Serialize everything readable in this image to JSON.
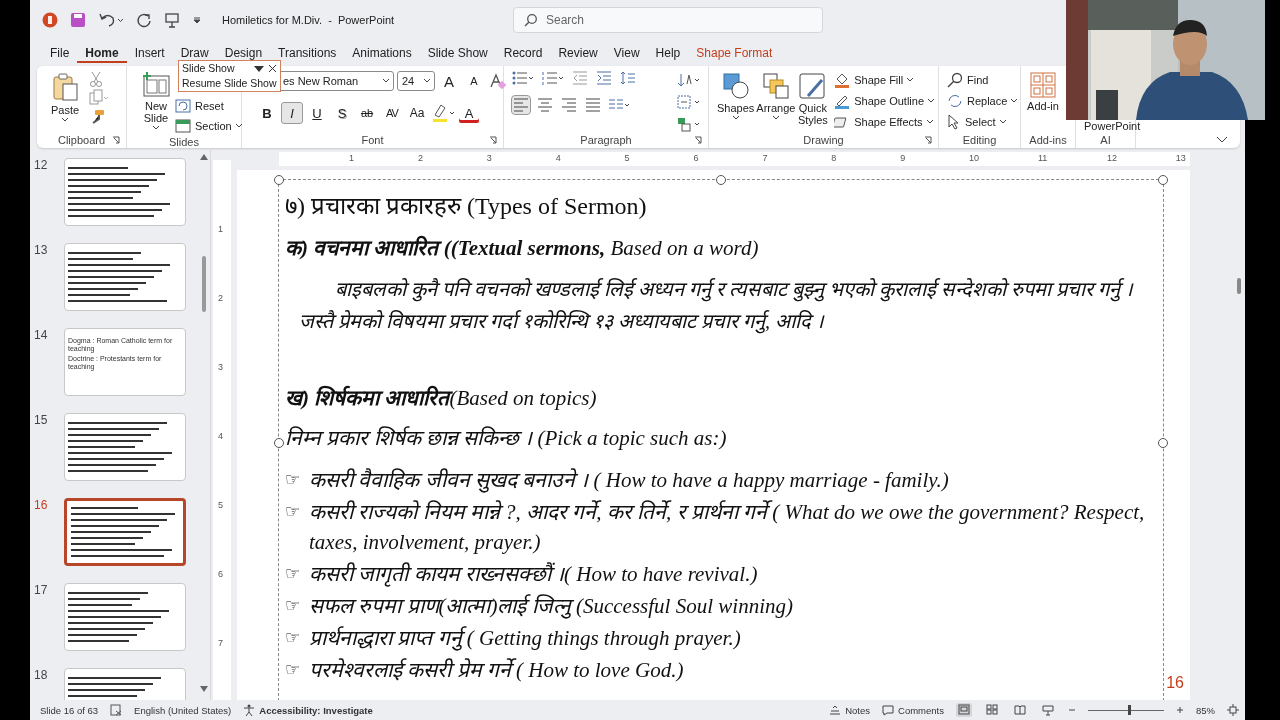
{
  "title_bar": {
    "title": "Homiletics for M.Div.  -  PowerPoint",
    "search_placeholder": "Search"
  },
  "tabs": [
    {
      "label": "File",
      "selected": false,
      "kind": "normal"
    },
    {
      "label": "Home",
      "selected": true,
      "kind": "normal"
    },
    {
      "label": "Insert",
      "selected": false,
      "kind": "normal"
    },
    {
      "label": "Draw",
      "selected": false,
      "kind": "normal"
    },
    {
      "label": "Design",
      "selected": false,
      "kind": "normal"
    },
    {
      "label": "Transitions",
      "selected": false,
      "kind": "normal"
    },
    {
      "label": "Animations",
      "selected": false,
      "kind": "normal"
    },
    {
      "label": "Slide Show",
      "selected": false,
      "kind": "normal"
    },
    {
      "label": "Record",
      "selected": false,
      "kind": "normal"
    },
    {
      "label": "Review",
      "selected": false,
      "kind": "normal"
    },
    {
      "label": "View",
      "selected": false,
      "kind": "normal"
    },
    {
      "label": "Help",
      "selected": false,
      "kind": "normal"
    },
    {
      "label": "Shape Format",
      "selected": false,
      "kind": "contextual"
    }
  ],
  "slideshow_popup": {
    "title": "Slide Show",
    "item": "Resume Slide Show"
  },
  "ribbon": {
    "clipboard": {
      "label": "Clipboard",
      "paste": "Paste"
    },
    "slides": {
      "label": "Slides",
      "new_slide": "New Slide",
      "reset": "Reset",
      "section": "Section"
    },
    "font": {
      "label": "Font",
      "font_name": "es New Roman",
      "font_size": "24",
      "grow": "A",
      "shrink": "A",
      "font_color": "A",
      "styles": [
        {
          "label": "B",
          "selected": false
        },
        {
          "label": "I",
          "selected": true
        },
        {
          "label": "U",
          "selected": false
        },
        {
          "label": "S",
          "selected": false
        },
        {
          "label": "ab",
          "selected": false
        },
        {
          "label": "AV",
          "selected": false
        },
        {
          "label": "Aa",
          "selected": false
        }
      ]
    },
    "paragraph": {
      "label": "Paragraph",
      "alignments": [
        {
          "selected": true
        },
        {
          "selected": false
        },
        {
          "selected": false
        },
        {
          "selected": false
        }
      ]
    },
    "drawing": {
      "label": "Drawing",
      "shapes": "Shapes",
      "arrange": "Arrange",
      "quick_styles": "Quick Styles",
      "shape_fill": "Shape Fill",
      "shape_outline": "Shape Outline",
      "shape_effects": "Shape Effects"
    },
    "editing": {
      "label": "Editing",
      "find": "Find",
      "replace": "Replace",
      "select": "Select"
    },
    "add_ins": {
      "label": "Add-ins",
      "button": "Add-in"
    },
    "ai": {
      "label": "AI",
      "button": "PowerPoint"
    }
  },
  "thumbnails": [
    {
      "number": "12",
      "selected": false,
      "kind": "lines"
    },
    {
      "number": "13",
      "selected": false,
      "kind": "lines"
    },
    {
      "number": "14",
      "selected": false,
      "kind": "text",
      "lines": [
        "Dogma : Roman Catholic term for teaching",
        "Doctrine : Protestants term for teaching"
      ]
    },
    {
      "number": "15",
      "selected": false,
      "kind": "lines"
    },
    {
      "number": "16",
      "selected": true,
      "kind": "lines"
    },
    {
      "number": "17",
      "selected": false,
      "kind": "lines"
    },
    {
      "number": "18",
      "selected": false,
      "kind": "lines"
    }
  ],
  "rulers": {
    "horizontal": [
      "1",
      "2",
      "3",
      "4",
      "5",
      "6",
      "7",
      "8",
      "9",
      "10",
      "11",
      "12",
      "13"
    ],
    "vertical": [
      "1",
      "2",
      "3",
      "4",
      "5",
      "6",
      "7"
    ]
  },
  "slide": {
    "blocks": [
      {
        "kind": "title",
        "text": "७) प्रचारका प्रकारहरु (Types of Sermon)"
      },
      {
        "kind": "heading",
        "text": "**क) वचनमा आधारित ((Textual sermons,** Based on a word)"
      },
      {
        "kind": "paragraph",
        "text": "बाइबलको कुनै पनि वचनको खण्डलाई लिई अध्यन गर्नु र त्यसबाट बुझ्नु भएको कुरालाई सन्देशको रुपमा प्रचार गर्नु । जस्तै प्रेमको विषयमा प्रचार गर्दा १कोरिन्थि १३ अध्यायबाट प्रचार गर्नु, आदि ।"
      },
      {
        "kind": "heading",
        "text": "**ख) शिर्षकमा आधारित**(Based on topics)"
      },
      {
        "kind": "line",
        "text": "निम्न प्रकार शिर्षक छान्न सकिन्छ । (Pick a topic such as:)"
      }
    ],
    "bullets": [
      {
        "bullet": "☞",
        "text": "कसरी वैवाहिक जीवन सुखद बनाउने । ( How to have a happy marriage - family.)"
      },
      {
        "bullet": "☞",
        "text": "कसरी राज्यको नियम मान्ने ?, आदर गर्ने, कर तिर्ने, र प्रार्थना गर्ने ( What do we owe the government? Respect, taxes, involvement, prayer.)"
      },
      {
        "bullet": "☞",
        "text": "कसरी जागृती कायम राख्नसक्छौं ।( How to have revival.)"
      },
      {
        "bullet": "☞",
        "text": "सफल रुपमा प्राण(आत्मा)लाई जित्नु (Successful Soul winning)"
      },
      {
        "bullet": "☞",
        "text": "प्रार्थनाद्धारा प्राप्त गर्नु  ( Getting things through prayer.)"
      },
      {
        "bullet": "☞",
        "text": "परमेश्वरलाई कसरी प्रेम गर्ने ( How to love God.)"
      }
    ],
    "slide_number": "16"
  },
  "status_bar": {
    "slide_info": "Slide 16 of 63",
    "language": "English (United States)",
    "accessibility": "Accessibility: Investigate",
    "notes": "Notes",
    "comments": "Comments",
    "views": [
      {
        "selected": true
      },
      {
        "selected": false
      },
      {
        "selected": false
      },
      {
        "selected": false
      }
    ],
    "zoom": {
      "level": 0.55,
      "reading": "85%"
    }
  }
}
